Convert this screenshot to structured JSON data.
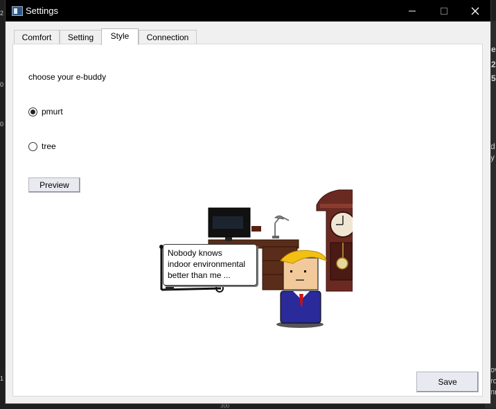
{
  "window": {
    "title": "Settings"
  },
  "tabs": [
    {
      "label": "Comfort"
    },
    {
      "label": "Setting"
    },
    {
      "label": "Style"
    },
    {
      "label": "Connection"
    }
  ],
  "style_tab": {
    "prompt": "choose your e-buddy",
    "options": [
      {
        "label": "pmurt",
        "selected": true
      },
      {
        "label": "tree",
        "selected": false
      }
    ],
    "preview_label": "Preview",
    "speech_bubble": [
      "Nobody knows",
      "indoor environmental",
      "better than me ..."
    ]
  },
  "save_label": "Save",
  "background_fragments": [
    "e",
    "2",
    "5",
    "d",
    "y",
    "2",
    "0",
    "0",
    "1",
    "ov",
    "ro",
    "nn",
    "300"
  ]
}
